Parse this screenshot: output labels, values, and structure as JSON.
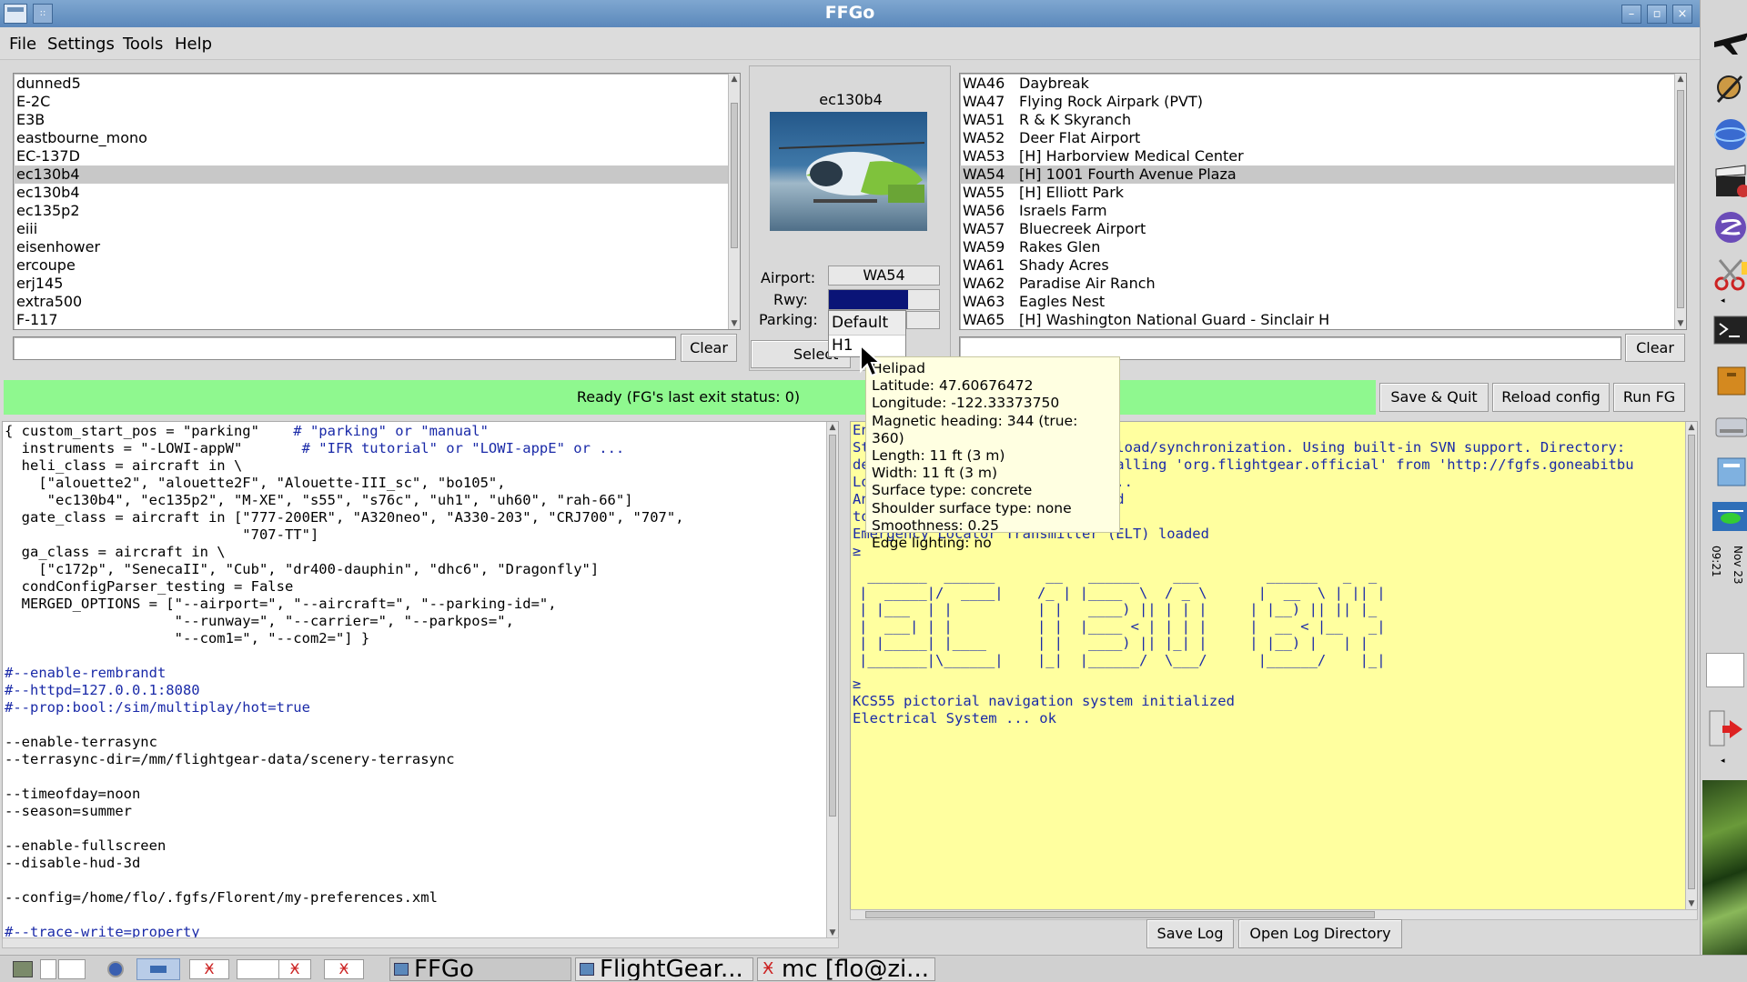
{
  "window": {
    "title": "FFGo"
  },
  "menu": [
    "File",
    "Settings",
    "Tools",
    "Help"
  ],
  "aircraft": {
    "items": [
      "dunned5",
      "E-2C",
      "E3B",
      "eastbourne_mono",
      "EC-137D",
      "ec130b4",
      "ec130b4",
      "ec135p2",
      "eiii",
      "eisenhower",
      "ercoupe",
      "erj145",
      "extra500",
      "F-117"
    ],
    "selected_index": 5,
    "filter_value": "",
    "clear_label": "Clear"
  },
  "center": {
    "aircraft_name": "ec130b4",
    "airport_label": "Airport:",
    "airport_value": "WA54",
    "rwy_label": "Rwy:",
    "parking_label": "Parking:",
    "select_label": "Select Sc",
    "dropdown_options": [
      "Default",
      "H1"
    ]
  },
  "airports": {
    "rows": [
      [
        "WA46",
        "Daybreak"
      ],
      [
        "WA47",
        "Flying Rock Airpark (PVT)"
      ],
      [
        "WA51",
        "R & K Skyranch"
      ],
      [
        "WA52",
        "Deer Flat Airport"
      ],
      [
        "WA53",
        "[H] Harborview Medical Center"
      ],
      [
        "WA54",
        "[H] 1001 Fourth Avenue Plaza"
      ],
      [
        "WA55",
        "[H] Elliott Park"
      ],
      [
        "WA56",
        "Israels Farm"
      ],
      [
        "WA57",
        "Bluecreek Airport"
      ],
      [
        "WA59",
        "Rakes Glen"
      ],
      [
        "WA61",
        "Shady Acres"
      ],
      [
        "WA62",
        "Paradise Air Ranch"
      ],
      [
        "WA63",
        "Eagles Nest"
      ],
      [
        "WA65",
        "[H] Washington National Guard - Sinclair H"
      ]
    ],
    "selected_index": 5,
    "filter_value": "",
    "clear_label": "Clear"
  },
  "status": {
    "text": "Ready (FG's last exit status: 0)",
    "save_quit": "Save & Quit",
    "reload": "Reload config",
    "run": "Run FG"
  },
  "config_lines": [
    [
      "{ custom_start_pos = \"parking\"    ",
      "# \"parking\" or \"manual\""
    ],
    [
      "  instruments = \"-LOWI-appW\"       ",
      "# \"IFR tutorial\" or \"LOWI-appE\" or ..."
    ],
    [
      "  heli_class = aircraft in \\",
      ""
    ],
    [
      "    [\"alouette2\", \"alouette2F\", \"Alouette-III_sc\", \"bo105\",",
      ""
    ],
    [
      "     \"ec130b4\", \"ec135p2\", \"M-XE\", \"s55\", \"s76c\", \"uh1\", \"uh60\", \"rah-66\"]",
      ""
    ],
    [
      "  gate_class = aircraft in [\"777-200ER\", \"A320neo\", \"A330-203\", \"CRJ700\", \"707\",",
      ""
    ],
    [
      "                            \"707-TT\"]",
      ""
    ],
    [
      "  ga_class = aircraft in \\",
      ""
    ],
    [
      "    [\"c172p\", \"SenecaII\", \"Cub\", \"dr400-dauphin\", \"dhc6\", \"Dragonfly\"]",
      ""
    ],
    [
      "  condConfigParser_testing = False",
      ""
    ],
    [
      "  MERGED_OPTIONS = [\"--airport=\", \"--aircraft=\", \"--parking-id=\",",
      ""
    ],
    [
      "                    \"--runway=\", \"--carrier=\", \"--parkpos=\",",
      ""
    ],
    [
      "                    \"--com1=\", \"--com2=\"] }",
      ""
    ],
    [
      "",
      ""
    ],
    [
      "",
      "#--enable-rembrandt"
    ],
    [
      "",
      "#--httpd=127.0.0.1:8080"
    ],
    [
      "",
      "#--prop:bool:/sim/multiplay/hot=true"
    ],
    [
      "",
      ""
    ],
    [
      "--enable-terrasync",
      ""
    ],
    [
      "--terrasync-dir=/mm/flightgear-data/scenery-terrasync",
      ""
    ],
    [
      "",
      ""
    ],
    [
      "--timeofday=noon",
      ""
    ],
    [
      "--season=summer",
      ""
    ],
    [
      "",
      ""
    ],
    [
      "--enable-fullscreen",
      ""
    ],
    [
      "--disable-hud-3d",
      ""
    ],
    [
      "",
      ""
    ],
    [
      "--config=/home/flo/.fgfs/Florent/my-preferences.xml",
      ""
    ],
    [
      "",
      ""
    ],
    [
      "",
      "#--trace-write=property"
    ]
  ],
  "log": {
    "lines_top": [
      "En",
      "St                           wnload/synchronization. Using built-in SVN support. Directory:",
      "de                           stalling 'org.flightgear.official' from 'http://fgfs.goneabitbu",
      "Lo                           s...",
      "An                           zed",
      "to",
      "Emergency Locator Transmitter (ELT) loaded",
      "≥"
    ],
    "banner": [
      " _______  ______      __   ______    ___        ______   _  _",
      "|  _____|/  ____|    /_ | |____  \\  / _ \\      |  __  \\ | || |",
      "| |___  | |          | |   ____) || | | |     | |__) || || |_",
      "|  ___| | |          | |  |____ < | | | |     |  __ < |__   _|",
      "| |_____| |____      | |   ____) || |_| |     | |__) |   | |",
      "|_______|\\______|    |_|  |______/  \\___/      |______/    |_|"
    ],
    "lines_bottom": [
      "≥",
      "KCS55 pictorial navigation system initialized",
      "Electrical System ... ok"
    ],
    "save_log": "Save Log",
    "open_dir": "Open Log Directory"
  },
  "tooltip": {
    "lines": [
      "Helipad",
      "Latitude: 47.60676472",
      "Longitude: -122.33373750",
      "Magnetic heading: 344 (true: 360)",
      "Length: 11 ft (3 m)",
      "Width: 11 ft (3 m)",
      "Surface type: concrete",
      "Shoulder surface type: none",
      "Smoothness: 0.25",
      "Edge lighting: no"
    ]
  },
  "taskbar": {
    "tasks": [
      "FFGo",
      "FlightGear...",
      "mc [flo@zi..."
    ],
    "clock_time": "09:21",
    "clock_date": "Nov 23"
  },
  "colors": {
    "status_bg": "#8ff88f",
    "log_bg": "#ffff9f",
    "log_text": "#1a2aa8",
    "comment": "#1a2aa8",
    "selection": "#c8c8c8",
    "titlebar": "#6892c2"
  }
}
